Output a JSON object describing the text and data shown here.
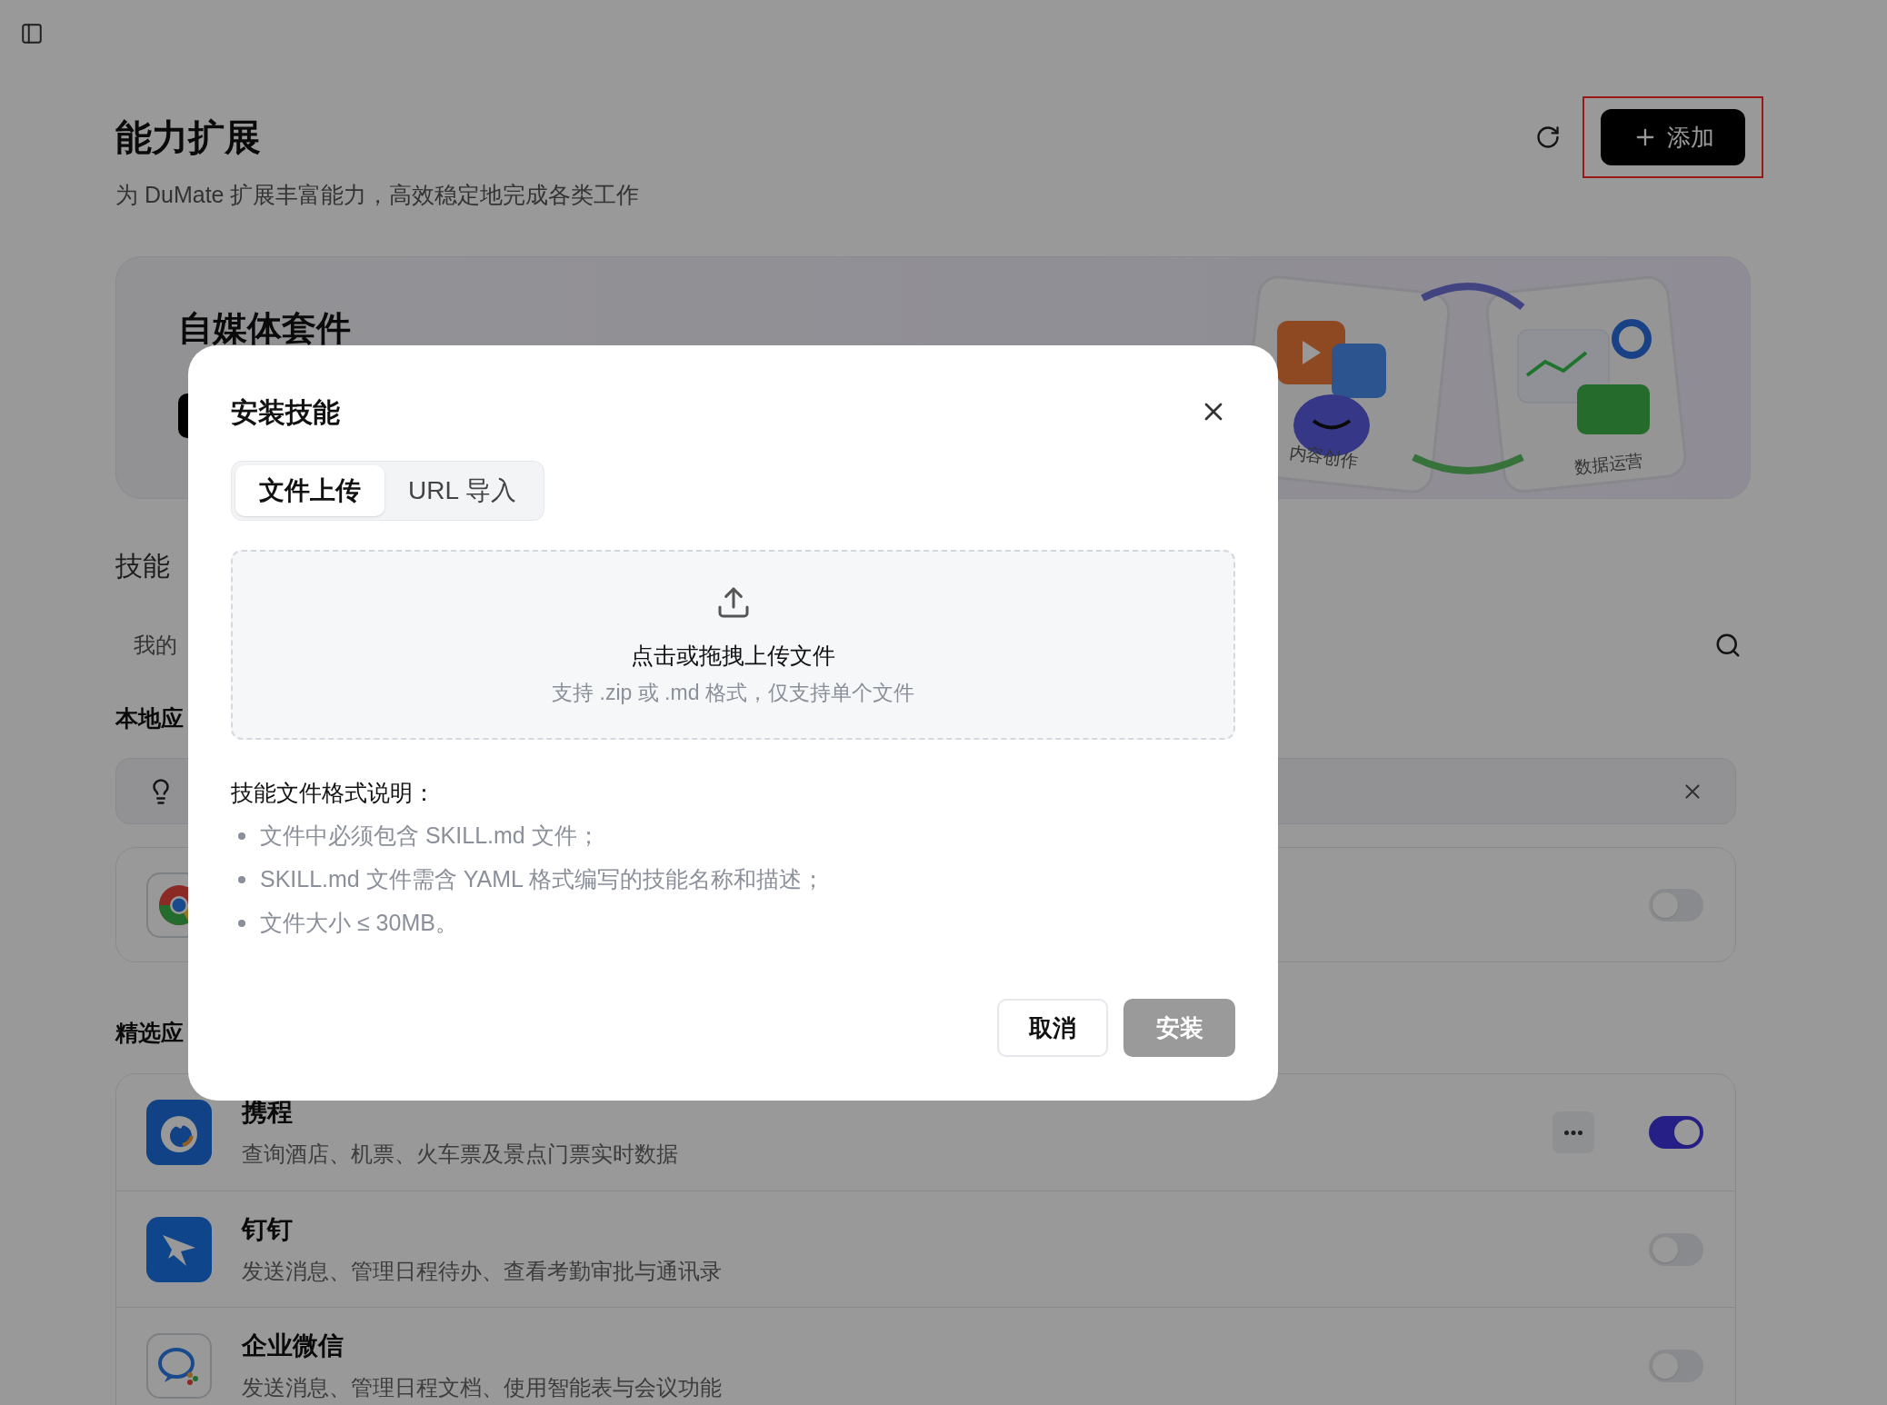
{
  "header": {
    "title": "能力扩展",
    "subtitle": "为 DuMate 扩展丰富能力，高效稳定地完成各类工作",
    "add_button": "添加",
    "add_highlighted": true
  },
  "banner": {
    "title": "自媒体套件",
    "illustration_labels": [
      "内容创作",
      "数据运营"
    ]
  },
  "skills": {
    "title": "技能",
    "tab": "我的"
  },
  "local": {
    "title": "本地应",
    "app": {
      "on": false
    }
  },
  "featured": {
    "title": "精选应",
    "items": [
      {
        "name": "携程",
        "description": "查询酒店、机票、火车票及景点门票实时数据",
        "kind": "dolphin",
        "menu": true,
        "on": true
      },
      {
        "name": "钉钉",
        "description": "发送消息、管理日程待办、查看考勤审批与通讯录",
        "kind": "wing",
        "menu": false,
        "on": false
      },
      {
        "name": "企业微信",
        "description": "发送消息、管理日程文档、使用智能表与会议功能",
        "kind": "chat",
        "menu": false,
        "on": false
      }
    ]
  },
  "dialog": {
    "title": "安装技能",
    "tabs": [
      {
        "label": "文件上传",
        "selected": true
      },
      {
        "label": "URL 导入",
        "selected": false
      }
    ],
    "upload": {
      "title": "点击或拖拽上传文件",
      "hint": "支持 .zip 或 .md 格式，仅支持单个文件"
    },
    "format_title": "技能文件格式说明：",
    "format_rules": [
      "文件中必须包含 SKILL.md 文件；",
      "SKILL.md 文件需含 YAML 格式编写的技能名称和描述；",
      "文件大小 ≤ 30MB。"
    ],
    "cancel": "取消",
    "install": {
      "label": "安装",
      "disabled": true
    }
  }
}
